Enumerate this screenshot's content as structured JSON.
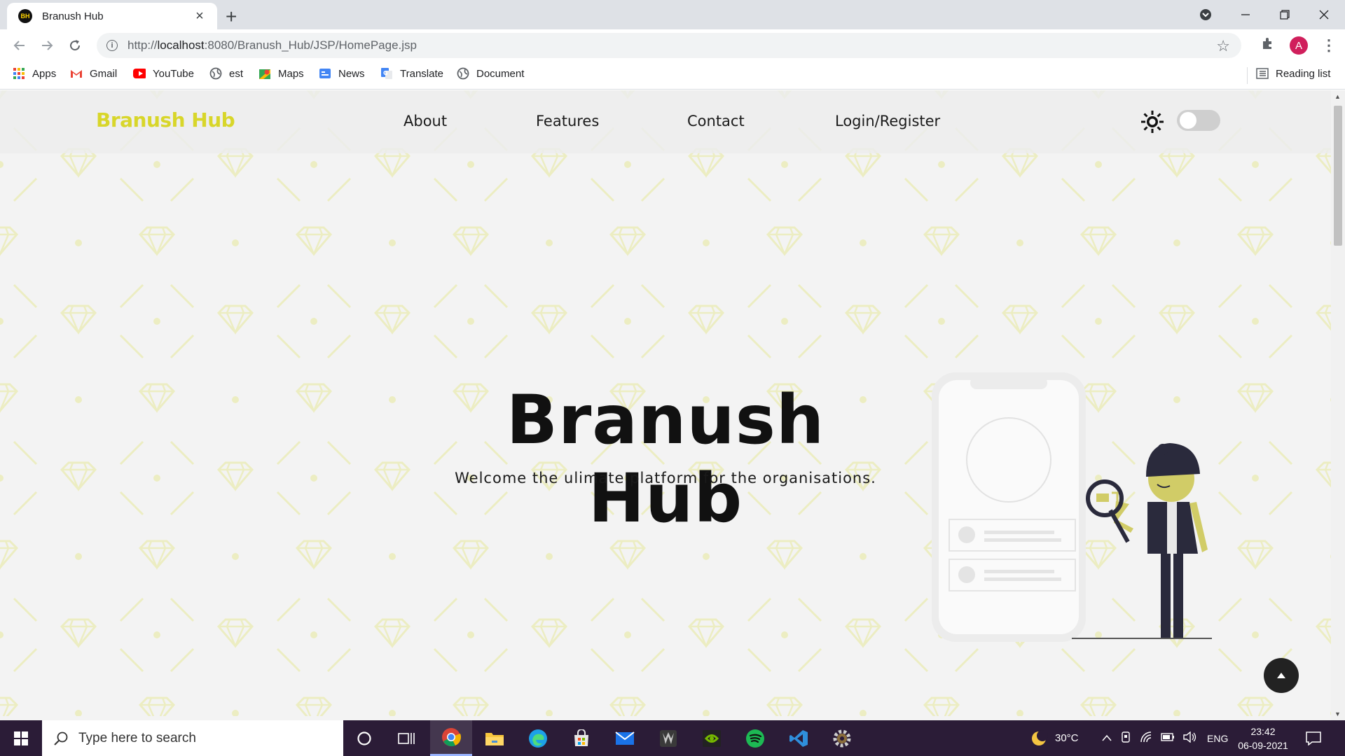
{
  "browser": {
    "tab_title": "Branush Hub",
    "tab_favicon_text": "BH",
    "url_prefix": "http://",
    "url_host": "localhost",
    "url_rest": ":8080/Branush_Hub/JSP/HomePage.jsp",
    "profile_initial": "A",
    "bookmarks": [
      {
        "label": "Apps",
        "icon": "apps-grid-icon"
      },
      {
        "label": "Gmail",
        "icon": "gmail-icon"
      },
      {
        "label": "YouTube",
        "icon": "youtube-icon"
      },
      {
        "label": "est",
        "icon": "globe-icon"
      },
      {
        "label": "Maps",
        "icon": "maps-icon"
      },
      {
        "label": "News",
        "icon": "news-icon"
      },
      {
        "label": "Translate",
        "icon": "translate-icon"
      },
      {
        "label": "Document",
        "icon": "globe-icon"
      }
    ],
    "reading_list": "Reading list"
  },
  "site": {
    "brand": "Branush Hub",
    "nav": [
      "About",
      "Features",
      "Contact",
      "Login/Register"
    ],
    "hero_title": "Branush Hub",
    "hero_subtitle": "Welcome the ulimate platform for the organisations.",
    "theme_toggle_on": false,
    "colors": {
      "accent": "#d8d62a",
      "background": "#f3f3f3",
      "pattern": "#ecedc2"
    }
  },
  "taskbar": {
    "search_placeholder": "Type here to search",
    "weather": "30°C",
    "language": "ENG",
    "time": "23:42",
    "date": "06-09-2021"
  }
}
